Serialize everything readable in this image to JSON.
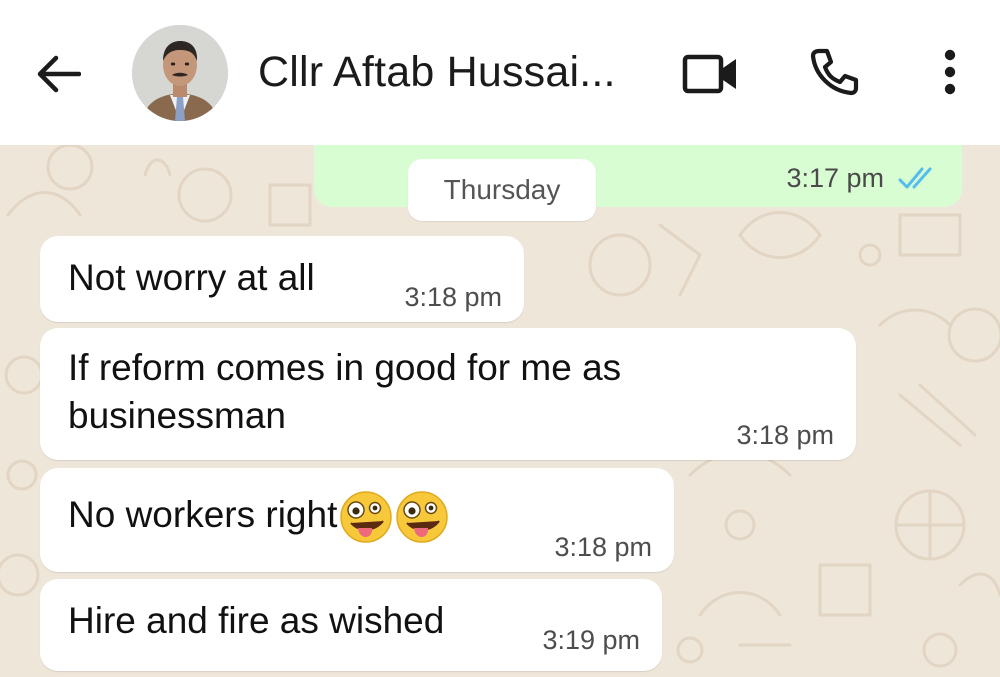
{
  "header": {
    "contact_name": "Cllr Aftab Hussai...",
    "icons": {
      "back": "arrow-left-icon",
      "avatar": "contact-avatar",
      "video": "video-call-icon",
      "call": "phone-icon",
      "menu": "more-vertical-icon"
    }
  },
  "chat": {
    "date_divider": "Thursday",
    "outgoing_last": {
      "time": "3:17 pm",
      "status": "read"
    },
    "messages": [
      {
        "text": "Not worry at all",
        "time": "3:18 pm"
      },
      {
        "text": "If reform comes in good for me as businessman",
        "text_lines": [
          "If reform comes in good for me as",
          "businessman"
        ],
        "time": "3:18 pm"
      },
      {
        "text": "No workers right",
        "emojis": [
          "zany-face",
          "zany-face"
        ],
        "time": "3:18 pm"
      },
      {
        "text": "Hire and fire as wished",
        "time": "3:19 pm"
      }
    ]
  },
  "colors": {
    "header_bg": "#ffffff",
    "chat_bg": "#efe6da",
    "outgoing_bubble": "#d9fdd3",
    "incoming_bubble": "#ffffff",
    "read_ticks": "#53bdeb"
  }
}
